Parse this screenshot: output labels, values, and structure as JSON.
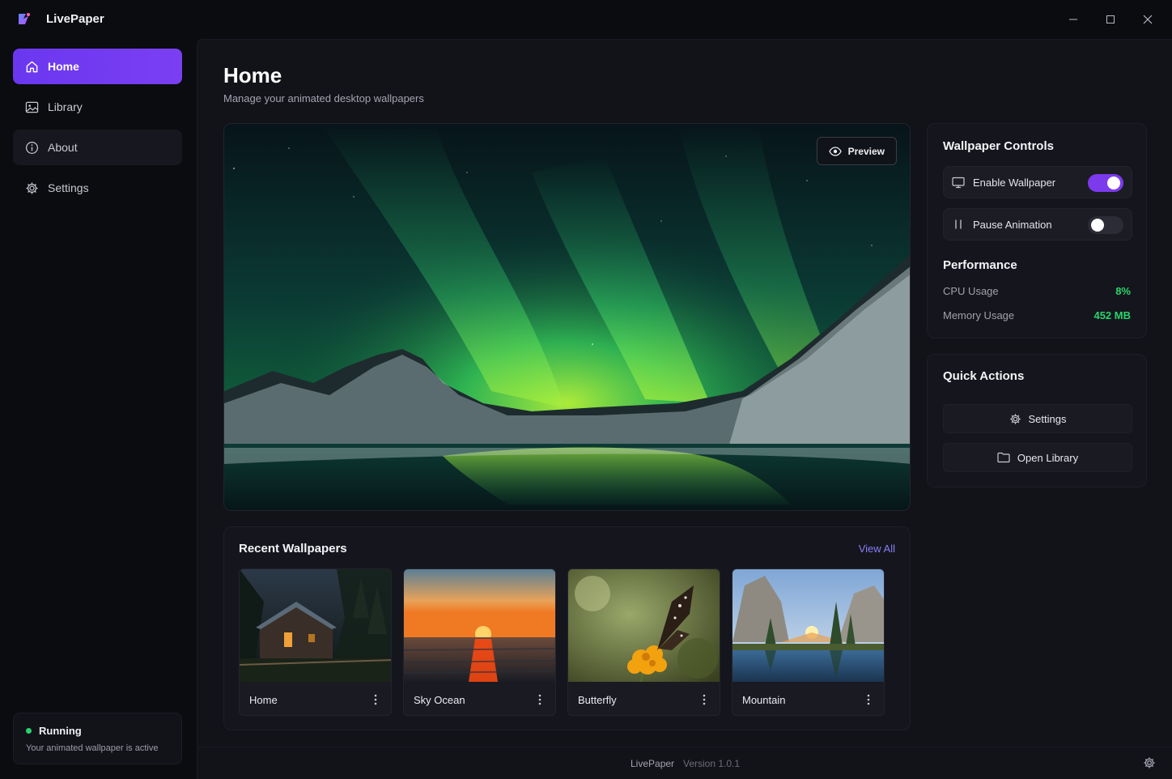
{
  "app": {
    "name": "LivePaper"
  },
  "sidebar": {
    "items": [
      {
        "label": "Home",
        "icon": "home-icon",
        "active": true
      },
      {
        "label": "Library",
        "icon": "image-icon",
        "active": false
      },
      {
        "label": "About",
        "icon": "info-icon",
        "active": false
      },
      {
        "label": "Settings",
        "icon": "gear-icon",
        "active": false
      }
    ],
    "status": {
      "title": "Running",
      "subtitle": "Your animated wallpaper is active",
      "color": "#2bd36b"
    }
  },
  "header": {
    "title": "Home",
    "subtitle": "Manage your animated desktop wallpapers"
  },
  "hero": {
    "preview_label": "Preview",
    "wallpaper": "aurora-over-mountains"
  },
  "controls": {
    "title": "Wallpaper Controls",
    "enable_label": "Enable Wallpaper",
    "enable_on": true,
    "pause_label": "Pause Animation",
    "pause_on": false
  },
  "performance": {
    "title": "Performance",
    "cpu_label": "CPU Usage",
    "cpu_value": "8%",
    "memory_label": "Memory Usage",
    "memory_value": "452 MB"
  },
  "quick_actions": {
    "title": "Quick Actions",
    "settings_label": "Settings",
    "library_label": "Open Library"
  },
  "recent": {
    "title": "Recent Wallpapers",
    "view_all": "View All",
    "items": [
      {
        "name": "Home"
      },
      {
        "name": "Sky Ocean"
      },
      {
        "name": "Butterfly"
      },
      {
        "name": "Mountain"
      }
    ]
  },
  "footer": {
    "app_name": "LivePaper",
    "version": "Version 1.0.1"
  },
  "colors": {
    "accent": "#7c3aed",
    "success": "#2bd36b",
    "link": "#8b7cf6"
  }
}
